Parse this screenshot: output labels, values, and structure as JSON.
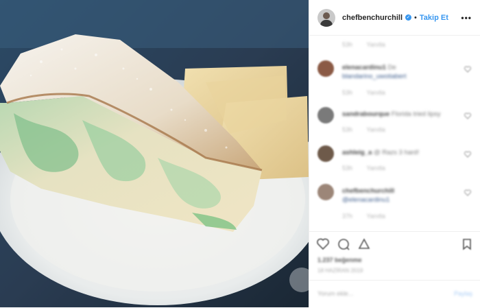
{
  "post": {
    "image_alt": "Slice of cake with powdered sugar and crackers on a white plate",
    "author": "chefbenchurchill",
    "separator": "•",
    "follow_label": "Takip Et",
    "more_label": "•••"
  },
  "comments": [
    {
      "meta_time": "53h",
      "meta_reply": "Yanıtla"
    },
    {
      "user": "elenacardinu1",
      "text": "De",
      "text2": "blandarino_uwotiabert",
      "meta_time": "53h",
      "meta_reply": "Yanıtla"
    },
    {
      "user": "sandrabourque",
      "text": "Florida tried lipsy",
      "meta_time": "53h",
      "meta_reply": "Yanıtla"
    },
    {
      "user": "ashleig_a",
      "text": "@ Razs 3 hard!",
      "meta_time": "53h",
      "meta_reply": "Yanıtla"
    },
    {
      "user": "chefbenchurchill",
      "text": "@elenacardinu1",
      "meta_time": "37h",
      "meta_reply": "Yanıtla"
    }
  ],
  "likes_text": "1.237 beğenme",
  "date_text": "18 HAZİRAN 2019",
  "add_comment": {
    "placeholder": "Yorum ekle...",
    "button": "Paylaş"
  },
  "colors": {
    "accent": "#3897f0",
    "divider": "#efefef",
    "text": "#262626"
  }
}
